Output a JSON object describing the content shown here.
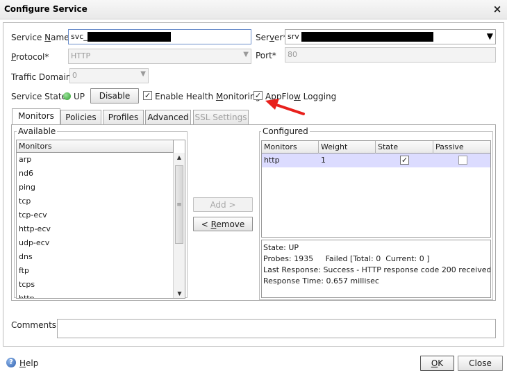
{
  "window": {
    "title": "Configure Service",
    "close_glyph": "×"
  },
  "service_name": {
    "label": "Service Name*",
    "value": "svc_"
  },
  "server": {
    "label": "Server*",
    "value": "srv"
  },
  "protocol": {
    "label": "Protocol*",
    "value": "HTTP"
  },
  "port": {
    "label": "Port*",
    "value": "80"
  },
  "traffic_domain": {
    "label": "Traffic Domain",
    "value": "0"
  },
  "service_state": {
    "label": "Service State",
    "value": "UP",
    "disable_button": "Disable",
    "status_color": "#2f9d2f"
  },
  "options": {
    "health_monitoring": {
      "label": "Enable Health Monitoring",
      "checked": true
    },
    "appflow_logging": {
      "label": "AppFlow Logging",
      "checked": true
    }
  },
  "tabs": [
    "Monitors",
    "Policies",
    "Profiles",
    "Advanced",
    "SSL Settings"
  ],
  "available": {
    "legend": "Available",
    "column": "Monitors",
    "items": [
      "arp",
      "nd6",
      "ping",
      "tcp",
      "tcp-ecv",
      "http-ecv",
      "udp-ecv",
      "dns",
      "ftp",
      "tcps",
      "http"
    ]
  },
  "buttons": {
    "add": "Add >",
    "remove": "< Remove",
    "ok": "OK",
    "close": "Close",
    "help": "Help"
  },
  "configured": {
    "legend": "Configured",
    "columns": [
      "Monitors",
      "Weight",
      "State",
      "Passive"
    ],
    "rows": [
      {
        "monitor": "http",
        "weight": "1",
        "state": true,
        "passive": false
      }
    ]
  },
  "monitor_status": {
    "state": "State: UP",
    "probes": "Probes: 1935     Failed [Total: 0  Current: 0 ]",
    "last_response": "Last Response: Success - HTTP response code 200 received.",
    "response_time": "Response Time: 0.657 millisec"
  },
  "comments": {
    "label": "Comments",
    "value": ""
  },
  "icons": {
    "help": "help-icon",
    "status": "status-dot-icon",
    "annotation": "red-arrow-icon"
  },
  "colors": {
    "selected_row": "#dcdcff",
    "annotation_arrow": "#e8201c"
  }
}
